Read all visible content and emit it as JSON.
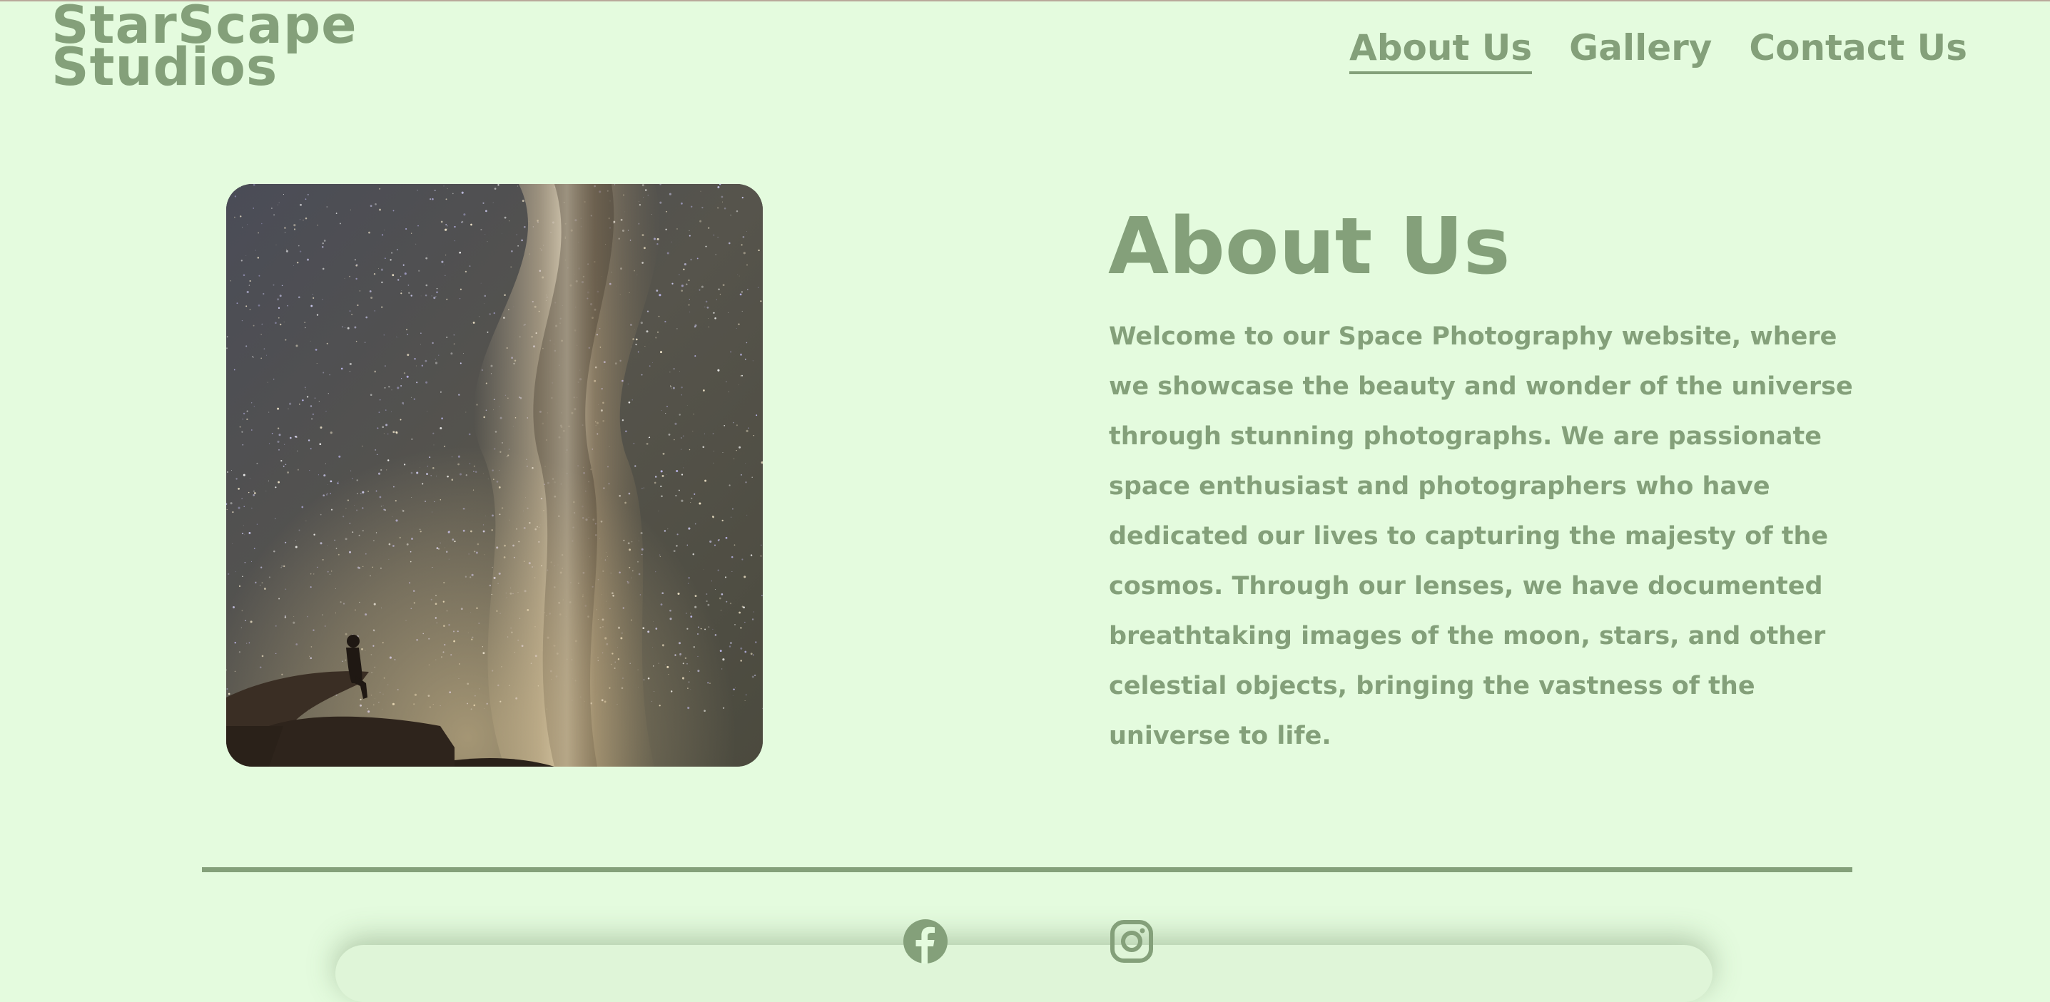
{
  "header": {
    "logo_line1": "StarScape",
    "logo_line2": "Studios",
    "nav": [
      {
        "label": "About Us",
        "active": true
      },
      {
        "label": "Gallery",
        "active": false
      },
      {
        "label": "Contact Us",
        "active": false
      }
    ]
  },
  "main": {
    "image": {
      "icon": "milky-way-photo",
      "subject": "person sitting on rock ledge under the Milky Way"
    },
    "title": "About Us",
    "body": "Welcome to our Space Photography website, where we showcase the beauty and wonder of the universe through stunning photographs. We are passionate space enthusiast and photographers who have dedicated our lives to capturing the majesty of the cosmos. Through our lenses, we have documented breathtaking images of the moon, stars, and other celestial objects, bringing the vastness of the universe to life."
  },
  "footer": {
    "social": [
      {
        "icon": "facebook-icon"
      },
      {
        "icon": "instagram-icon"
      }
    ]
  },
  "colors": {
    "background": "#e4fbde",
    "accent": "#84a07a"
  }
}
